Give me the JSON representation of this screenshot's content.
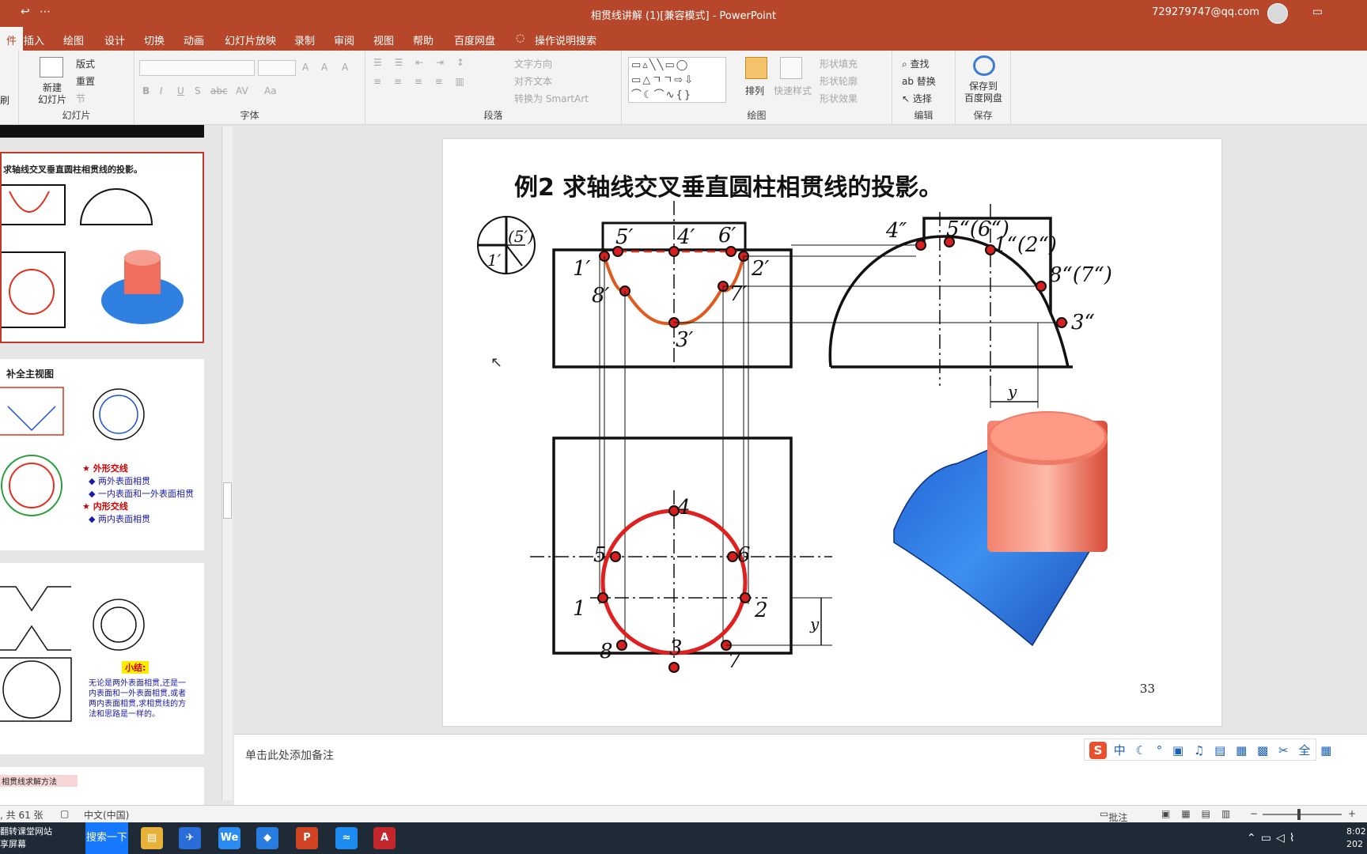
{
  "titlebar": {
    "title": "相贯线讲解 (1)[兼容模式]  -  PowerPoint",
    "account": "729279747@qq.com",
    "qa_icon": "↩",
    "qa_more": "⋯"
  },
  "menu_tabs": [
    "插入",
    "绘图",
    "设计",
    "切换",
    "动画",
    "幻灯片放映",
    "录制",
    "审阅",
    "视图",
    "帮助",
    "百度网盘"
  ],
  "menu_active_tab": "件",
  "tell_me": "操作说明搜索",
  "ribbon": {
    "slides": {
      "label": "幻灯片",
      "new_slide": "新建",
      "new_slide2": "幻灯片",
      "layout": "版式",
      "reset": "重置",
      "section": "节"
    },
    "clipboard_partial": "刷",
    "font": {
      "label": "字体",
      "bold": "B",
      "italic": "I",
      "underline": "U",
      "shadow": "S",
      "strike": "abc",
      "spacing": "AV",
      "case": "Aa",
      "grow": "A",
      "shrink": "A",
      "clear": "A"
    },
    "paragraph": {
      "label": "段落",
      "text_dir": "文字方向",
      "align_text": "对齐文本",
      "smartart": "转换为 SmartArt"
    },
    "drawing": {
      "label": "绘图",
      "arrange": "排列",
      "quick_styles": "快速样式",
      "fill": "形状填充",
      "outline": "形状轮廓",
      "effects": "形状效果"
    },
    "editing": {
      "label": "编辑",
      "find": "查找",
      "replace": "替换",
      "select": "选择"
    },
    "save": {
      "label": "保存",
      "btn1": "保存到",
      "btn2": "百度网盘"
    }
  },
  "thumbnails": {
    "t1_title": "求轴线交叉垂直圆柱相贯线的投影。",
    "t2_title": "补全主视图",
    "t2_b1": "外形交线",
    "t2_b1a": "两外表面相贯",
    "t2_b1b": "一内表面和一外表面相贯",
    "t2_b2": "内形交线",
    "t2_b2a": "两内表面相贯",
    "t3_badge": "小结:",
    "t3_text": "无论是两外表面相贯,还是一内表面和一外表面相贯,或者两内表面相贯,求相贯线的方法和思路是一样的。",
    "t4_title": "相贯线求解方法"
  },
  "slide": {
    "title": "例2  求轴线交叉垂直圆柱相贯线的投影。",
    "page": "33",
    "front_labels": [
      "5′",
      "4′",
      "6′",
      "1′",
      "2′",
      "8′",
      "7′",
      "3′"
    ],
    "side_labels": [
      "4″",
      "5“(6“)",
      "1“(2“)",
      "8“(7“)",
      "3“"
    ],
    "top_labels": [
      "4",
      "5",
      "6",
      "1",
      "2",
      "8",
      "3",
      "7"
    ],
    "dim": "y",
    "corner_marks": [
      "(5′)",
      "1′"
    ]
  },
  "notes_hint": "单击此处添加备注",
  "status": {
    "slides": ", 共 61 张",
    "lang": "中文(中国)",
    "comments": "批注"
  },
  "taskbar": {
    "search": "搜索一下",
    "left_text": "翻转课堂网站",
    "left_text2": "享屏幕",
    "time": "8:02",
    "date": "202"
  },
  "colors": {
    "accent": "#b7472a",
    "curve": "#e0301e",
    "point": "#d81e1e"
  }
}
